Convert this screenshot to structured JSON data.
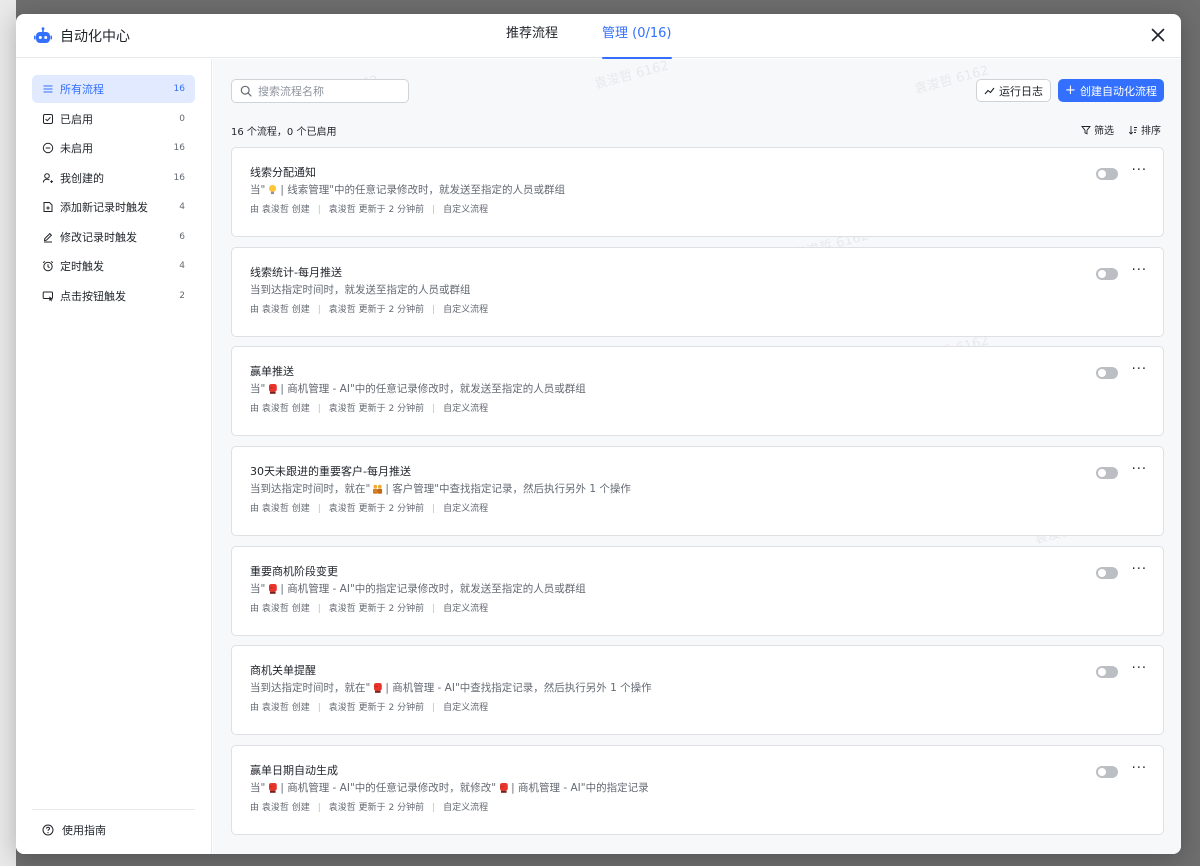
{
  "app": {
    "title": "自动化中心"
  },
  "tabs": [
    {
      "label": "推荐流程",
      "active": false
    },
    {
      "label": "管理 (0/16)",
      "active": true
    }
  ],
  "sidebar": {
    "items": [
      {
        "label": "所有流程",
        "count": "16",
        "icon": "list-icon",
        "active": true
      },
      {
        "label": "已启用",
        "count": "0",
        "icon": "checkbox-icon",
        "active": false
      },
      {
        "label": "未启用",
        "count": "16",
        "icon": "minus-circle-icon",
        "active": false
      },
      {
        "label": "我创建的",
        "count": "16",
        "icon": "user-add-icon",
        "active": false
      },
      {
        "label": "添加新记录时触发",
        "count": "4",
        "icon": "add-record-icon",
        "active": false
      },
      {
        "label": "修改记录时触发",
        "count": "6",
        "icon": "edit-icon",
        "active": false
      },
      {
        "label": "定时触发",
        "count": "4",
        "icon": "alarm-icon",
        "active": false
      },
      {
        "label": "点击按钮触发",
        "count": "2",
        "icon": "click-button-icon",
        "active": false
      }
    ],
    "footer": "使用指南"
  },
  "toolbar": {
    "search_placeholder": "搜索流程名称",
    "log_label": "运行日志",
    "create_label": "创建自动化流程"
  },
  "summary": "16 个流程，0 个已启用",
  "tools": {
    "filter": "筛选",
    "sort": "排序"
  },
  "cards": [
    {
      "title": "线索分配通知",
      "desc": [
        "当\"",
        "bulb-emoji",
        " | 线索管理\"中的任意记录修改时，就发送至指定的人员或群组"
      ],
      "meta": [
        "由 袁浚哲 创建",
        "袁浚哲 更新于 2 分钟前",
        "自定义流程"
      ]
    },
    {
      "title": "线索统计-每月推送",
      "desc": [
        "当到达指定时间时，就发送至指定的人员或群组"
      ],
      "meta": [
        "由 袁浚哲 创建",
        "袁浚哲 更新于 2 分钟前",
        "自定义流程"
      ]
    },
    {
      "title": "赢单推送",
      "desc": [
        "当\"",
        "boxing-glove-emoji",
        " | 商机管理 - AI\"中的任意记录修改时，就发送至指定的人员或群组"
      ],
      "meta": [
        "由 袁浚哲 创建",
        "袁浚哲 更新于 2 分钟前",
        "自定义流程"
      ]
    },
    {
      "title": "30天未跟进的重要客户-每月推送",
      "desc": [
        "当到达指定时间时，就在\"",
        "people-emoji",
        " | 客户管理\"中查找指定记录，然后执行另外 1 个操作"
      ],
      "meta": [
        "由 袁浚哲 创建",
        "袁浚哲 更新于 2 分钟前",
        "自定义流程"
      ]
    },
    {
      "title": "重要商机阶段变更",
      "desc": [
        "当\"",
        "boxing-glove-emoji",
        " | 商机管理 - AI\"中的指定记录修改时，就发送至指定的人员或群组"
      ],
      "meta": [
        "由 袁浚哲 创建",
        "袁浚哲 更新于 2 分钟前",
        "自定义流程"
      ]
    },
    {
      "title": "商机关单提醒",
      "desc": [
        "当到达指定时间时，就在\"",
        "boxing-glove-emoji",
        " | 商机管理 - AI\"中查找指定记录，然后执行另外 1 个操作"
      ],
      "meta": [
        "由 袁浚哲 创建",
        "袁浚哲 更新于 2 分钟前",
        "自定义流程"
      ]
    },
    {
      "title": "赢单日期自动生成",
      "desc": [
        "当\"",
        "boxing-glove-emoji",
        " | 商机管理 - AI\"中的任意记录修改时，就修改\"",
        "boxing-glove-emoji",
        " | 商机管理 - AI\"中的指定记录"
      ],
      "meta": [
        "由 袁浚哲 创建",
        "袁浚哲 更新于 2 分钟前",
        "自定义流程"
      ]
    }
  ],
  "watermark": "袁浚哲 6162",
  "colors": {
    "accent": "#3370ff",
    "active_bg": "#e1eaff",
    "text": "#1f2329",
    "muted": "#646a73"
  }
}
